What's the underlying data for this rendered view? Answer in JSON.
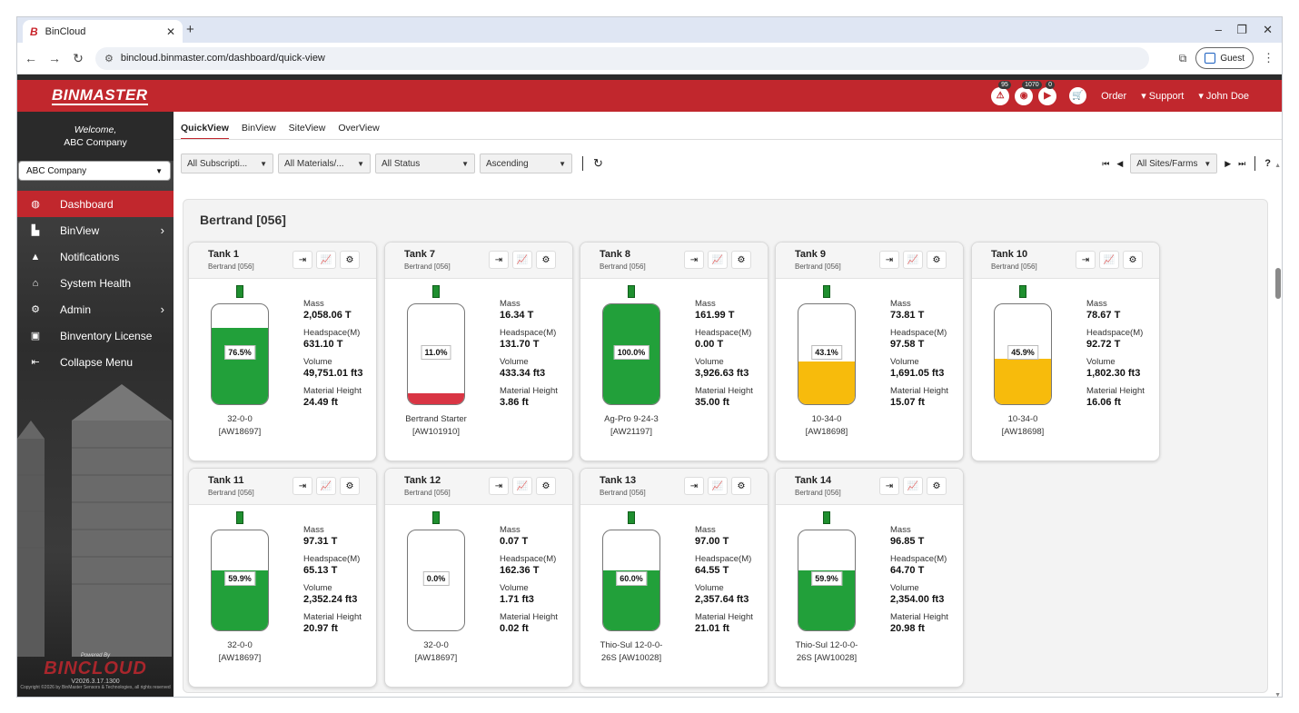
{
  "browser": {
    "tab_title": "BinCloud",
    "favicon": "B",
    "url": "bincloud.binmaster.com/dashboard/quick-view",
    "guest_label": "Guest"
  },
  "appbar": {
    "logo": "BINMASTER",
    "alert_badges": [
      "95",
      "1070",
      "0"
    ],
    "order_label": "Order",
    "support_label": "Support",
    "user_label": "John Doe"
  },
  "sidebar": {
    "welcome_line1": "Welcome,",
    "welcome_line2": "ABC Company",
    "company_select": "ABC Company",
    "items": [
      {
        "label": "Dashboard",
        "icon": "globe-icon",
        "active": true
      },
      {
        "label": "BinView",
        "icon": "silo-icon",
        "chevron": true
      },
      {
        "label": "Notifications",
        "icon": "bell-icon"
      },
      {
        "label": "System Health",
        "icon": "health-icon"
      },
      {
        "label": "Admin",
        "icon": "cogs-icon",
        "chevron": true
      },
      {
        "label": "Binventory License",
        "icon": "license-icon"
      },
      {
        "label": "Collapse Menu",
        "icon": "collapse-icon"
      }
    ],
    "powered_by": "Powered By",
    "powered_logo": "BINCLOUD",
    "version": "V2026.3.17.1300",
    "copyright": "Copyright ©2026 by BinMaster Sensors & Technologies, all rights reserved"
  },
  "main": {
    "tabs": [
      {
        "label": "QuickView",
        "active": true
      },
      {
        "label": "BinView"
      },
      {
        "label": "SiteView"
      },
      {
        "label": "OverView"
      }
    ],
    "filters": {
      "subscriptions": "All Subscripti...",
      "materials": "All Materials/...",
      "status": "All Status",
      "order": "Ascending",
      "sites": "All Sites/Farms"
    },
    "help": "?",
    "group_title": "Bertrand [056]"
  },
  "colors": {
    "brand_red": "#c1272d",
    "fill_green": "#22a03a",
    "fill_yellow": "#f7bb0c",
    "fill_red": "#d93544"
  },
  "labels": {
    "mass": "Mass",
    "headspace": "Headspace(M)",
    "volume": "Volume",
    "material_height": "Material Height"
  },
  "tanks": [
    {
      "name": "Tank 1",
      "site": "Bertrand [056]",
      "level": 76.5,
      "pct": "76.5%",
      "fill": "green",
      "mass": "2,058.06 T",
      "headspace": "631.10 T",
      "volume": "49,751.01 ft3",
      "height": "24.49 ft",
      "material": "32-0-0",
      "code": "[AW18697]"
    },
    {
      "name": "Tank 7",
      "site": "Bertrand [056]",
      "level": 11.0,
      "pct": "11.0%",
      "fill": "red",
      "mass": "16.34 T",
      "headspace": "131.70 T",
      "volume": "433.34 ft3",
      "height": "3.86 ft",
      "material": "Bertrand Starter",
      "code": "[AW101910]"
    },
    {
      "name": "Tank 8",
      "site": "Bertrand [056]",
      "level": 100.0,
      "pct": "100.0%",
      "fill": "green",
      "mass": "161.99 T",
      "headspace": "0.00 T",
      "volume": "3,926.63 ft3",
      "height": "35.00 ft",
      "material": "Ag-Pro 9-24-3",
      "code": "[AW21197]"
    },
    {
      "name": "Tank 9",
      "site": "Bertrand [056]",
      "level": 43.1,
      "pct": "43.1%",
      "fill": "yellow",
      "mass": "73.81 T",
      "headspace": "97.58 T",
      "volume": "1,691.05 ft3",
      "height": "15.07 ft",
      "material": "10-34-0",
      "code": "[AW18698]"
    },
    {
      "name": "Tank 10",
      "site": "Bertrand [056]",
      "level": 45.9,
      "pct": "45.9%",
      "fill": "yellow",
      "mass": "78.67 T",
      "headspace": "92.72 T",
      "volume": "1,802.30 ft3",
      "height": "16.06 ft",
      "material": "10-34-0",
      "code": "[AW18698]"
    },
    {
      "name": "Tank 11",
      "site": "Bertrand [056]",
      "level": 59.9,
      "pct": "59.9%",
      "fill": "green",
      "mass": "97.31 T",
      "headspace": "65.13 T",
      "volume": "2,352.24 ft3",
      "height": "20.97 ft",
      "material": "32-0-0",
      "code": "[AW18697]"
    },
    {
      "name": "Tank 12",
      "site": "Bertrand [056]",
      "level": 0.0,
      "pct": "0.0%",
      "fill": "green",
      "mass": "0.07 T",
      "headspace": "162.36 T",
      "volume": "1.71 ft3",
      "height": "0.02 ft",
      "material": "32-0-0",
      "code": "[AW18697]"
    },
    {
      "name": "Tank 13",
      "site": "Bertrand [056]",
      "level": 60.0,
      "pct": "60.0%",
      "fill": "green",
      "mass": "97.00 T",
      "headspace": "64.55 T",
      "volume": "2,357.64 ft3",
      "height": "21.01 ft",
      "material": "Thio-Sul 12-0-0-",
      "code": "26S [AW10028]"
    },
    {
      "name": "Tank 14",
      "site": "Bertrand [056]",
      "level": 59.9,
      "pct": "59.9%",
      "fill": "green",
      "mass": "96.85 T",
      "headspace": "64.70 T",
      "volume": "2,354.00 ft3",
      "height": "20.98 ft",
      "material": "Thio-Sul 12-0-0-",
      "code": "26S [AW10028]"
    }
  ]
}
